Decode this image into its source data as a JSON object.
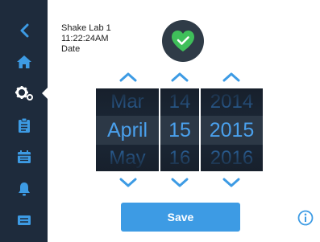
{
  "device": {
    "name": "Shake Lab 1",
    "time": "11:22:24AM",
    "screen_title": "Date",
    "status": "ok"
  },
  "sidebar": {
    "items": [
      {
        "name": "back",
        "icon": "chevron-left-icon"
      },
      {
        "name": "home",
        "icon": "home-icon"
      },
      {
        "name": "settings",
        "icon": "gears-icon",
        "active": true
      },
      {
        "name": "notes",
        "icon": "clipboard-icon"
      },
      {
        "name": "calendar",
        "icon": "calendar-icon"
      },
      {
        "name": "alarms",
        "icon": "bell-icon"
      },
      {
        "name": "messages",
        "icon": "message-icon"
      }
    ]
  },
  "date_picker": {
    "month": {
      "prev": "Mar",
      "selected": "April",
      "next": "May"
    },
    "day": {
      "prev": "14",
      "selected": "15",
      "next": "16"
    },
    "year": {
      "prev": "2014",
      "selected": "2015",
      "next": "2016"
    }
  },
  "actions": {
    "save_label": "Save"
  },
  "colors": {
    "sidebar_bg": "#1e2b3c",
    "accent": "#3d9be4",
    "status_ok": "#3fbf5a"
  }
}
